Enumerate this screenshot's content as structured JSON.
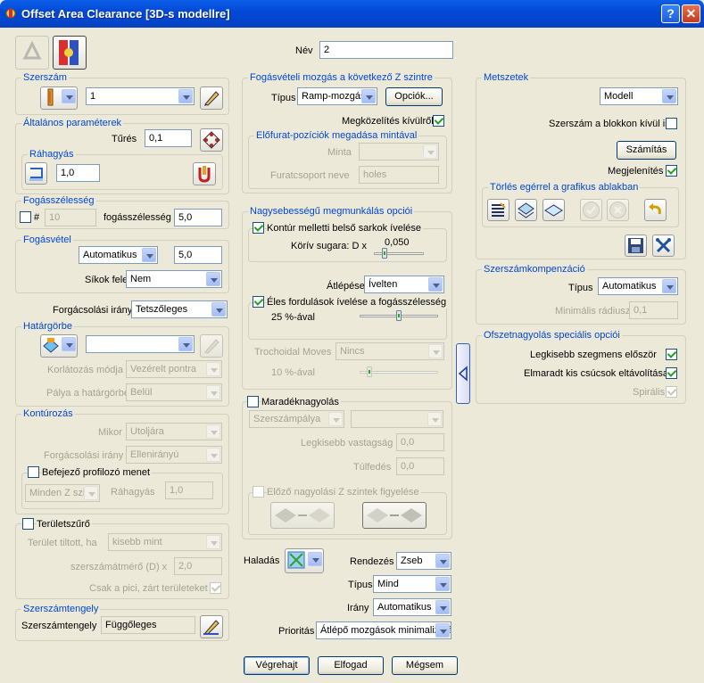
{
  "window": {
    "title": "Offset Area Clearance [3D-s modellre]",
    "help_label": "?",
    "close_label": "✕"
  },
  "header": {
    "nev_label": "Név",
    "nev_value": "2"
  },
  "szerszam": {
    "legend": "Szerszám",
    "tool_value": "1"
  },
  "altalanos": {
    "legend": "Általános paraméterek",
    "tures_label": "Tűrés",
    "tures_value": "0,1",
    "rahagyas_legend": "Ráhagyás",
    "rahagyas_value": "1,0"
  },
  "fogasszelesseg": {
    "legend": "Fogásszélesség",
    "hash_label": "#",
    "hash_value": "10",
    "fsz_label": "fogásszélesség",
    "fsz_value": "5,0"
  },
  "fogasvetel": {
    "legend": "Fogásvétel",
    "mode_value": "Automatikus",
    "value": "5,0",
    "sikok_label": "Síkok felett",
    "sikok_value": "Nem"
  },
  "forgacsolasi": {
    "label": "Forgácsolási irány",
    "value": "Tetszőleges"
  },
  "hatargorbe": {
    "legend": "Határgörbe",
    "curve_value": "",
    "korl_label": "Korlátozás módja",
    "korl_value": "Vezérelt pontra",
    "palya_label": "Pálya a határgörbén",
    "palya_value": "Belül"
  },
  "konturozas": {
    "legend": "Kontúrozás",
    "mikor_label": "Mikor",
    "mikor_value": "Utoljára",
    "irany_label": "Forgácsolási irány",
    "irany_value": "Ellenirányú",
    "befejezo_label": "Befejező profilozó menet",
    "minden_value": "Minden Z szint",
    "rahagyas_label": "Ráhagyás",
    "rahagyas_value": "1,0"
  },
  "teruletszuro": {
    "label": "Területszűrő",
    "tiltott_label": "Terület tiltott, ha",
    "tiltott_value": "kisebb mint",
    "atmero_label": "szerszámátmérő (D) x",
    "atmero_value": "2,0",
    "csak_label": "Csak a pici, zárt területeket"
  },
  "szerszamtengely": {
    "legend": "Szerszámtengely",
    "label": "Szerszámtengely",
    "value": "Függőleges"
  },
  "fogasveteli_mozgas": {
    "legend": "Fogásvételi mozgás a következő Z szintre",
    "tipus_label": "Típus",
    "tipus_value": "Ramp-mozgás",
    "opciok_label": "Opciók...",
    "megkozelites_label": "Megközelítés kívülről",
    "elofurat_legend": "Előfurat-pozíciók megadása mintával",
    "minta_label": "Minta",
    "minta_value": "",
    "furat_label": "Furatcsoport neve",
    "furat_value": "holes"
  },
  "nagysebessegu": {
    "legend": "Nagysebességű megmunkálás opciói",
    "kontur_label": "Kontúr melletti belső sarkok ívelése",
    "korivsugar_label": "Körív sugara: D x",
    "korivsugar_value": "0,050",
    "atlepesek_label": "Átlépések",
    "atlepesek_value": "Ívelten",
    "eles_label": "Éles fordulások ívelése a fogásszélesség",
    "eles_pct": "25 %-ával",
    "eles_fraction": 0.25,
    "trochoidal_label": "Trochoidal Moves",
    "trochoidal_value": "Nincs",
    "troch_pct": "10 %-ával",
    "troch_fraction": 0.1
  },
  "maradek": {
    "label": "Maradéknagyolás",
    "palya_value": "Szerszámpálya",
    "second_value": "",
    "legkisebb_label": "Legkisebb vastagság",
    "legkisebb_value": "0,0",
    "tulfedes_label": "Túlfedés",
    "tulfedes_value": "0,0",
    "elozo_label": "Előző nagyolási Z szintek figyelése"
  },
  "haladas": {
    "label": "Haladás",
    "rendezes_label": "Rendezés",
    "rendezes_value": "Zseb",
    "tipus_label": "Típus",
    "tipus_value": "Mind",
    "irany_label": "Irány",
    "irany_value": "Automatikus",
    "prioritas_label": "Prioritás",
    "prioritas_value": "Átlépő mozgások minimalizálása"
  },
  "metszetek": {
    "legend": "Metszetek",
    "model_value": "Modell",
    "blokkon_label": "Szerszám a blokkon kívül is",
    "szamitas_label": "Számítás",
    "megjelenites_label": "Megjelenítés",
    "torles_legend": "Törlés egérrel a grafikus ablakban"
  },
  "szerszamkomp": {
    "legend": "Szerszámkompenzáció",
    "tipus_label": "Típus",
    "tipus_value": "Automatikus",
    "minrad_label": "Minimális rádiusz",
    "minrad_value": "0,1"
  },
  "ofszet": {
    "legend": "Ofszetnagyolás speciális opciói",
    "legkisebb_label": "Legkisebb szegmens először",
    "elmaradt_label": "Elmaradt kis csúcsok eltávolítása",
    "spiralis_label": "Spirális"
  },
  "buttons": {
    "vegrehajt": "Végrehajt",
    "elfogad": "Elfogad",
    "megsem": "Mégsem"
  },
  "colors": {
    "title_bar": "#0349d6",
    "legend_text": "#0046d5",
    "dialog_bg": "#ece9d8",
    "check_green": "#21a121"
  }
}
